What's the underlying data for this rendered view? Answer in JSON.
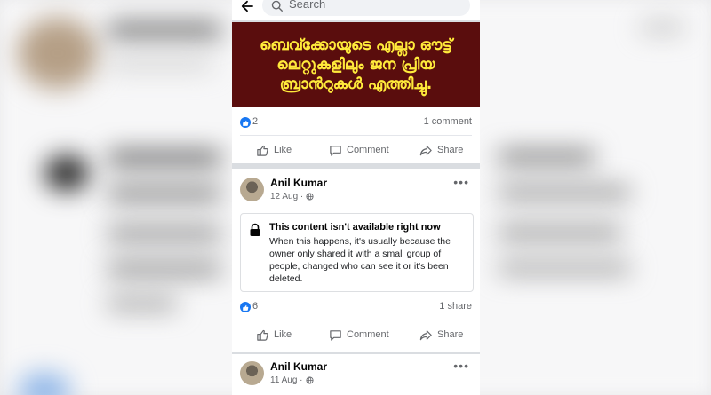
{
  "search": {
    "placeholder": "Search"
  },
  "post1": {
    "image_text": "ബെവ്ക്കോയുടെ എല്ലാ ഔട്ട് ലെറ്റുകളിലും ജന പ്രിയ ബ്രാൻറുകൾ എത്തിച്ചു.",
    "likes": "2",
    "comments": "1 comment"
  },
  "post2": {
    "author": "Anil Kumar",
    "date": "12 Aug ·",
    "unavailable_title": "This content isn't available right now",
    "unavailable_body": "When this happens, it's usually because the owner only shared it with a small group of people, changed who can see it or it's been deleted.",
    "likes": "6",
    "shares": "1 share"
  },
  "post3": {
    "author": "Anil Kumar",
    "date": "11 Aug ·"
  },
  "actions": {
    "like": "Like",
    "comment": "Comment",
    "share": "Share"
  },
  "more": "•••",
  "colors": {
    "accent": "#1877f2",
    "banner_bg": "#5a0d0d",
    "banner_text": "#ffea3b"
  }
}
